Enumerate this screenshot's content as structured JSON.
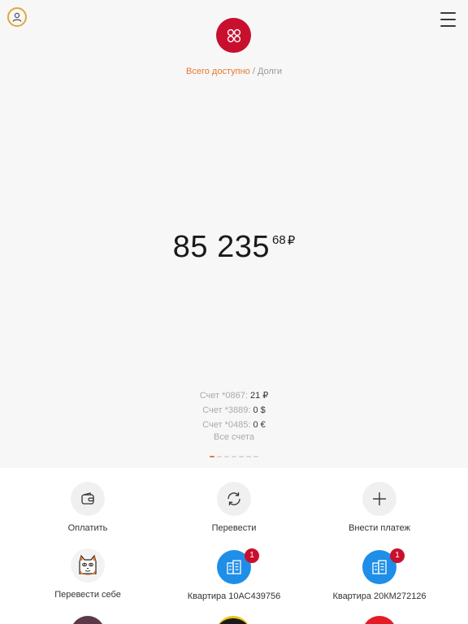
{
  "header": {
    "profile_icon": "user-circle-icon",
    "menu_icon": "hamburger-menu-icon",
    "logo_icon": "bank-logo-icon"
  },
  "breadcrumb": {
    "active": "Всего доступно",
    "separator": " / ",
    "inactive": "Долги"
  },
  "balance": {
    "integer": "85 235",
    "fraction": "68",
    "currency": "₽"
  },
  "accounts": [
    {
      "label": "Счет *0867:",
      "amount": "21 ₽"
    },
    {
      "label": "Счет *3889:",
      "amount": "0 $"
    },
    {
      "label": "Счет *0485:",
      "amount": "0 €"
    }
  ],
  "all_accounts": "Все счета",
  "pager": {
    "count": 7,
    "active": 0
  },
  "actions": [
    {
      "label": "Оплатить",
      "icon": "wallet-icon"
    },
    {
      "label": "Перевести",
      "icon": "refresh-arrows-icon"
    },
    {
      "label": "Внести платеж",
      "icon": "plus-icon"
    }
  ],
  "favorites": [
    {
      "label": "Перевести себе",
      "icon": "cat-avatar-icon"
    },
    {
      "label": "Квартира 10АС439756",
      "icon": "building-icon",
      "badge": "1"
    },
    {
      "label": "Квартира 20КМ272126",
      "icon": "building-icon",
      "badge": "1"
    }
  ],
  "colors": {
    "accent": "#e8792a",
    "brand_red": "#c8102e",
    "blue": "#1f8ee8"
  }
}
